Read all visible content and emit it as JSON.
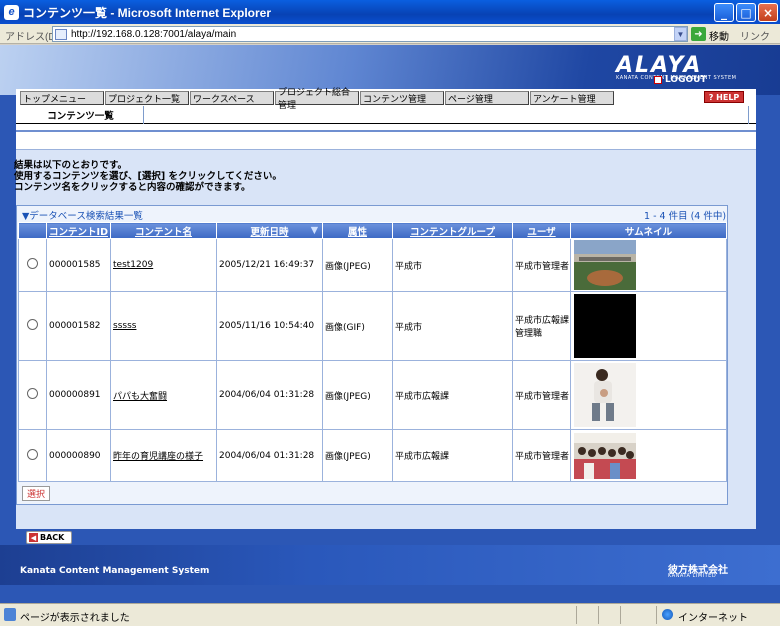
{
  "window": {
    "title": "コンテンツ一覧 - Microsoft Internet Explorer"
  },
  "addressbar": {
    "label": "アドレス(D)",
    "url": "http://192.168.0.128:7001/alaya/main",
    "go_label": "移動",
    "links_label": "リンク"
  },
  "header": {
    "logo": "ALAYA",
    "logo_sub": "KANATA CONTENT MANAGEMENT SYSTEM",
    "logout": "LOGOUT",
    "help": "HELP"
  },
  "menu": {
    "items": [
      "トップメニュー",
      "プロジェクト一覧",
      "ワークスペース",
      "プロジェクト総合管理",
      "コンテンツ管理",
      "ページ管理",
      "アンケート管理"
    ]
  },
  "subtab": {
    "label": "コンテンツ一覧"
  },
  "info": {
    "lines": [
      "結果は以下のとおりです。",
      "使用するコンテンツを選び、[選択] をクリックしてください。",
      "コンテンツ名をクリックすると内容の確認ができます。"
    ]
  },
  "results": {
    "title": "▼データベース検索結果一覧",
    "count": "1 - 4 件目 (4 件中)",
    "columns": [
      "",
      "コンテントID",
      "コンテント名",
      "更新日時",
      "属性",
      "コンテントグループ",
      "ユーザ",
      "サムネイル"
    ],
    "sort_indicator": "▼",
    "rows": [
      {
        "id": "000001585",
        "name": "test1209",
        "date": "2005/12/21 16:49:37",
        "attr": "画像(JPEG)",
        "group": "平成市",
        "user": "平成市管理者",
        "thumb": "baseball-field"
      },
      {
        "id": "000001582",
        "name": "sssss",
        "date": "2005/11/16 10:54:40",
        "attr": "画像(GIF)",
        "group": "平成市",
        "user": "平成市広報課管理職",
        "thumb": "black"
      },
      {
        "id": "000000891",
        "name": "パパも大奮闘",
        "date": "2004/06/04 01:31:28",
        "attr": "画像(JPEG)",
        "group": "平成市広報課",
        "user": "平成市管理者",
        "thumb": "father-child"
      },
      {
        "id": "000000890",
        "name": "昨年の育児講座の様子",
        "date": "2004/06/04 01:31:28",
        "attr": "画像(JPEG)",
        "group": "平成市広報課",
        "user": "平成市管理者",
        "thumb": "group-photo"
      }
    ],
    "select_label": "選択"
  },
  "back": {
    "label": "BACK"
  },
  "footer": {
    "text": "Kanata Content Management System",
    "logo": "彼方株式会社",
    "logo_sub": "KANATA LIMITED"
  },
  "status": {
    "text": "ページが表示されました",
    "zone": "インターネット"
  }
}
